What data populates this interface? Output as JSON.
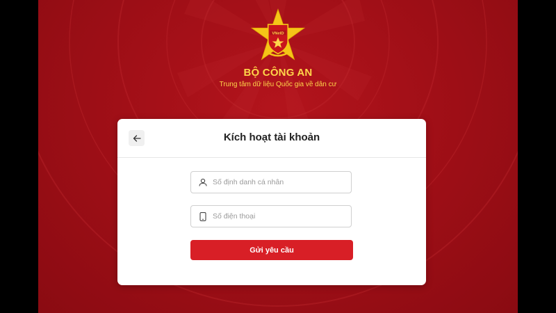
{
  "header": {
    "org_name": "BỘ CÔNG AN",
    "org_subtitle": "Trung tâm dữ liệu Quốc gia về dân cư",
    "emblem_text": "VNeID"
  },
  "card": {
    "title": "Kích hoạt tài khoản",
    "back_icon": "arrow-left-icon"
  },
  "form": {
    "id_placeholder": "Số định danh cá nhân",
    "id_icon": "user-icon",
    "phone_placeholder": "Số điện thoại",
    "phone_icon": "phone-icon",
    "submit_label": "Gửi yêu cầu"
  },
  "colors": {
    "background_red": "#a10f17",
    "accent_gold": "#ffd54a",
    "button_red": "#d81f26"
  }
}
